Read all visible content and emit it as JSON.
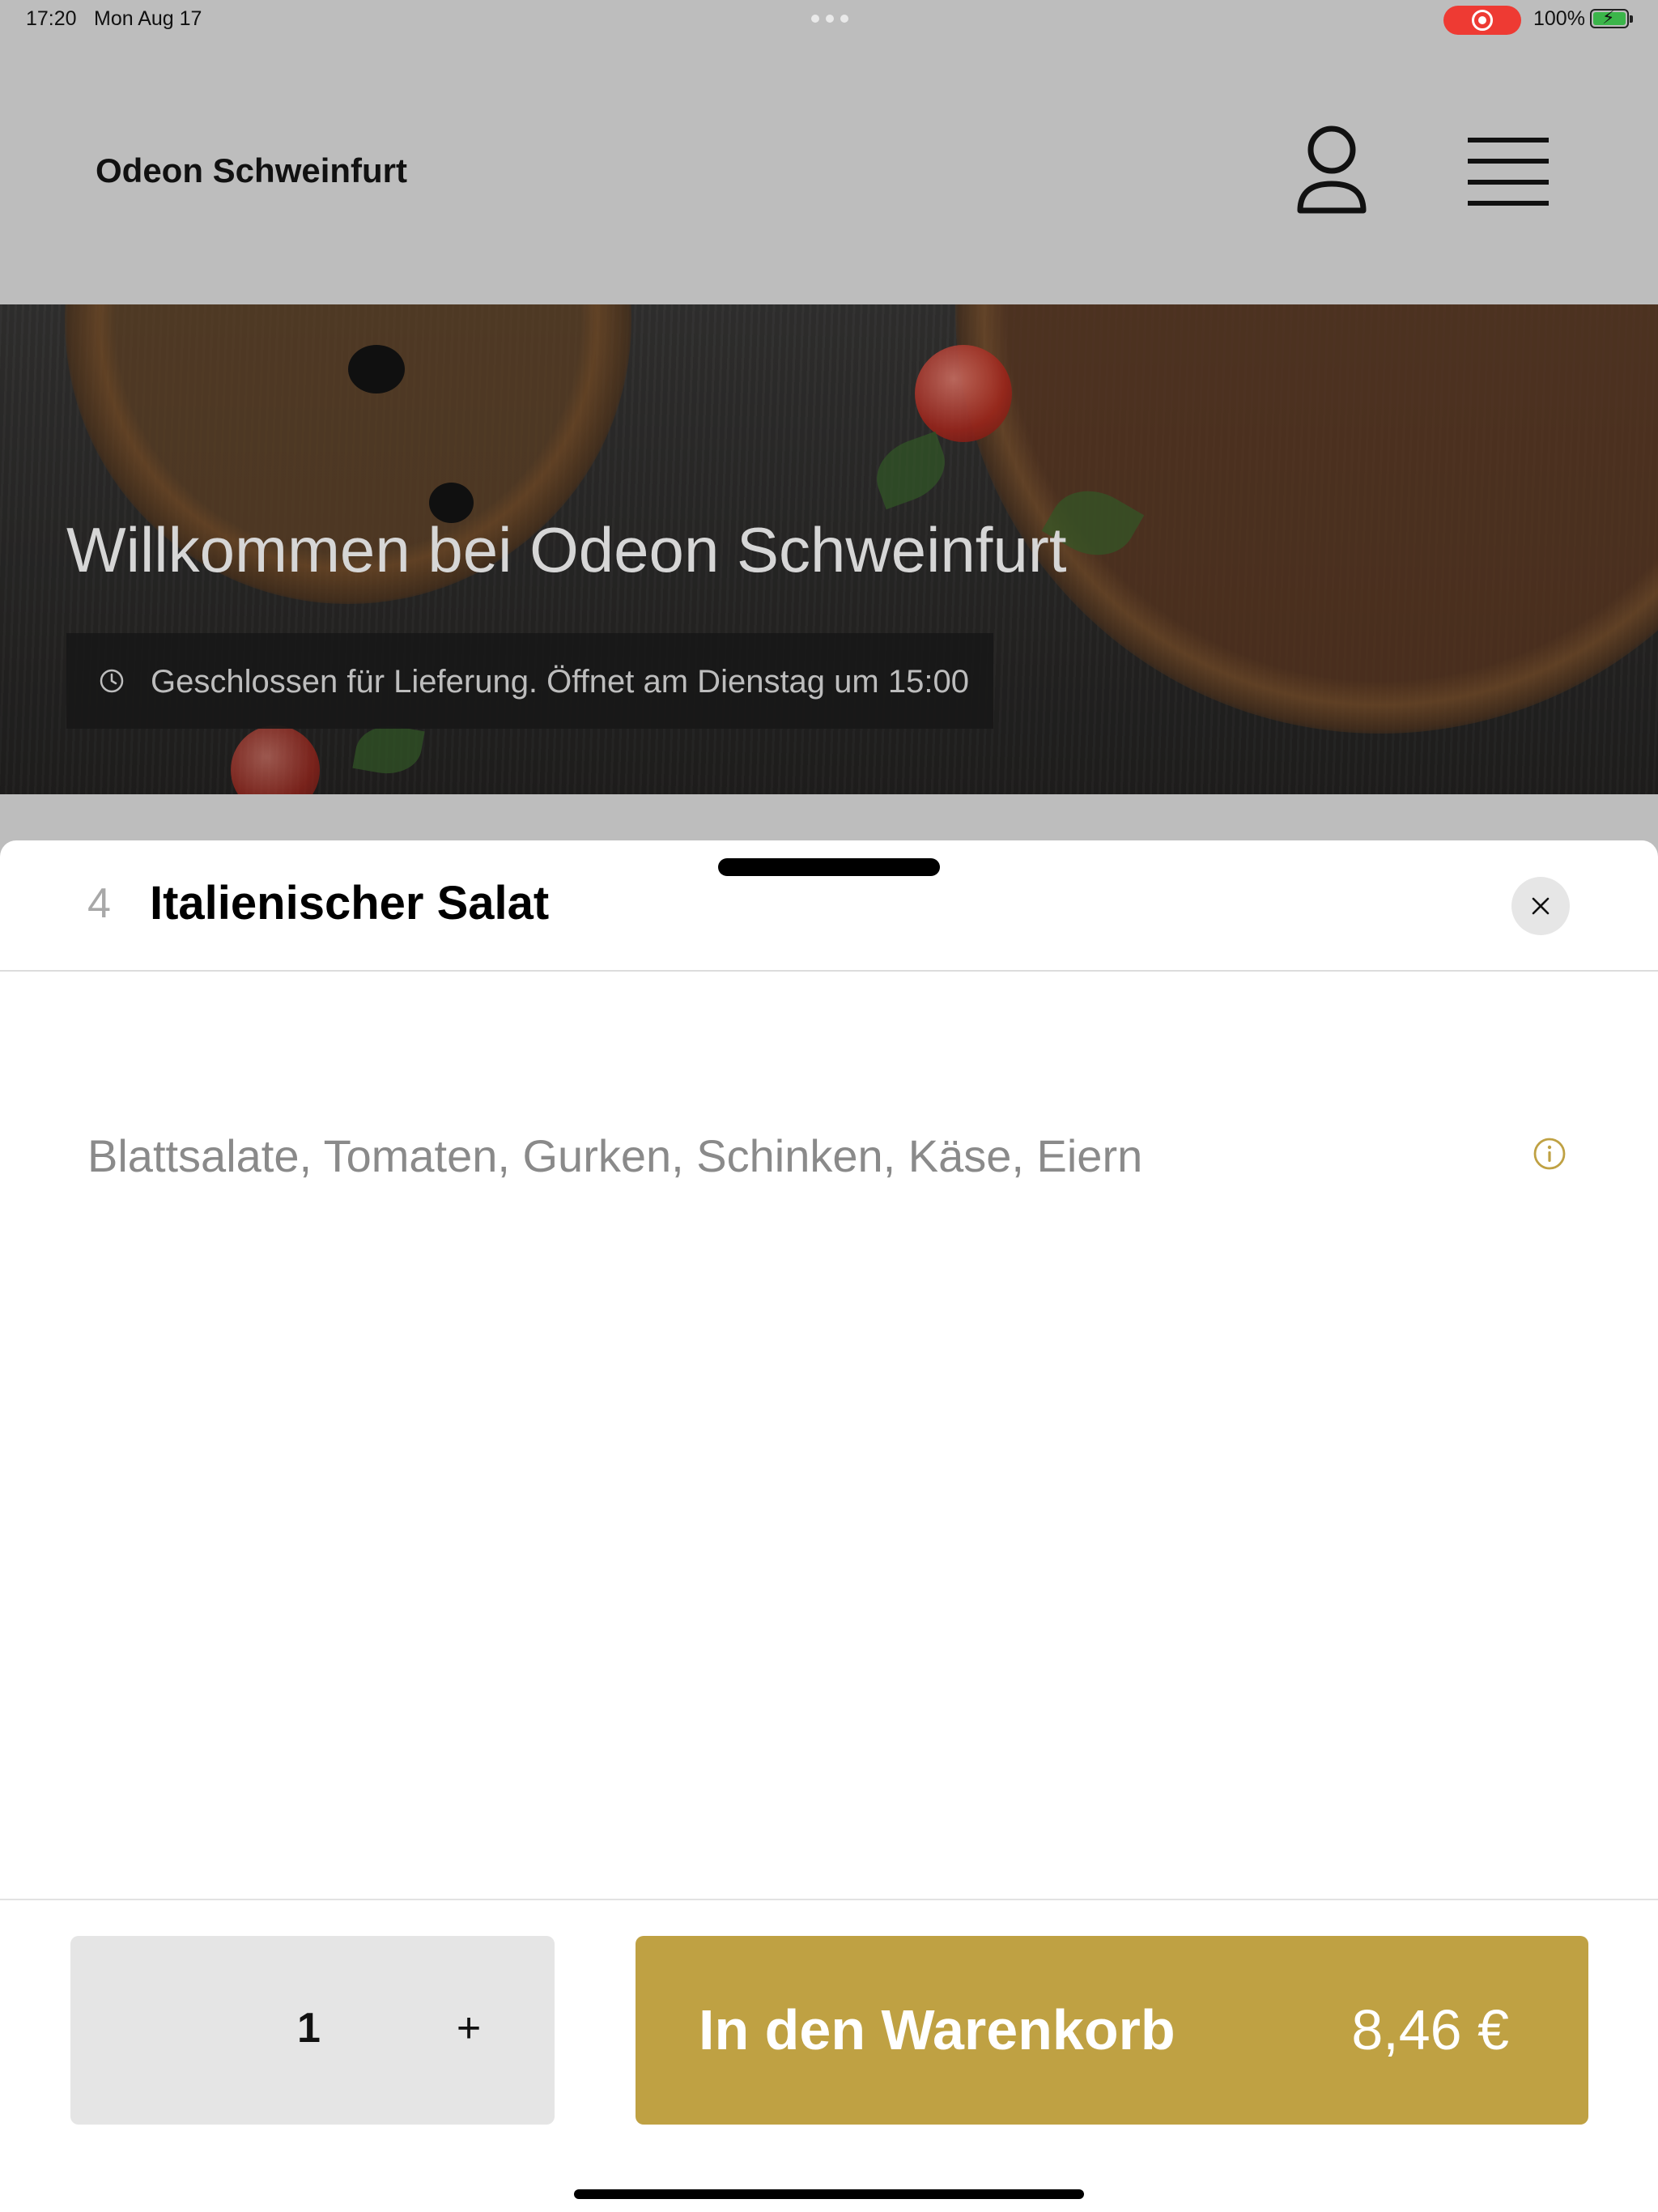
{
  "status_bar": {
    "time": "17:20",
    "date": "Mon Aug 17",
    "battery": "100%"
  },
  "header": {
    "brand": "Odeon Schweinfurt",
    "icons": [
      "user-icon",
      "menu-icon"
    ]
  },
  "hero": {
    "title": "Willkommen bei Odeon Schweinfurt",
    "closed_notice": "Geschlossen für Lieferung. Öffnet am Dienstag um 15:00"
  },
  "item_sheet": {
    "number": "4",
    "title": "Italienischer Salat",
    "description": "Blattsalate, Tomaten, Gurken, Schinken, Käse, Eiern",
    "quantity": "1",
    "plus_label": "+",
    "add_to_cart_label": "In den Warenkorb",
    "price": "8,46 €"
  },
  "colors": {
    "accent": "#bfa143",
    "header_bg": "#bdbdbd",
    "record_indicator": "#ee3a33"
  }
}
